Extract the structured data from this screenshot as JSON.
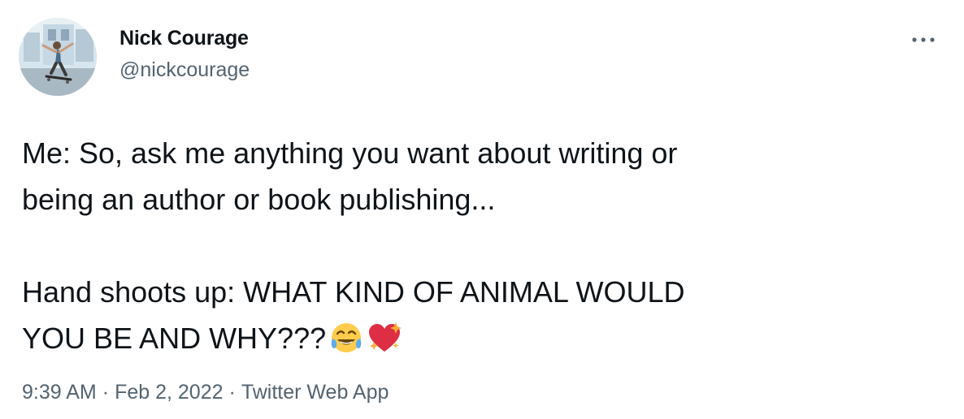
{
  "user": {
    "display_name": "Nick Courage",
    "handle": "@nickcourage",
    "avatar": "avatar-skateboarder"
  },
  "tweet": {
    "line1": "Me: So, ask me anything you want about writing or",
    "line2": "being an author or book publishing...",
    "line3": "Hand shoots up: WHAT KIND OF ANIMAL WOULD",
    "line4": "YOU BE AND WHY???",
    "emojis": [
      "face-with-tears-of-joy-icon",
      "sparkling-heart-icon"
    ]
  },
  "meta": {
    "time": "9:39 AM",
    "separator": "·",
    "date": "Feb 2, 2022",
    "source": "Twitter Web App"
  },
  "actions": {
    "more_icon": "more-horizontal-icon"
  },
  "colors": {
    "text": "#0f1419",
    "secondary": "#536471",
    "background": "#ffffff"
  }
}
